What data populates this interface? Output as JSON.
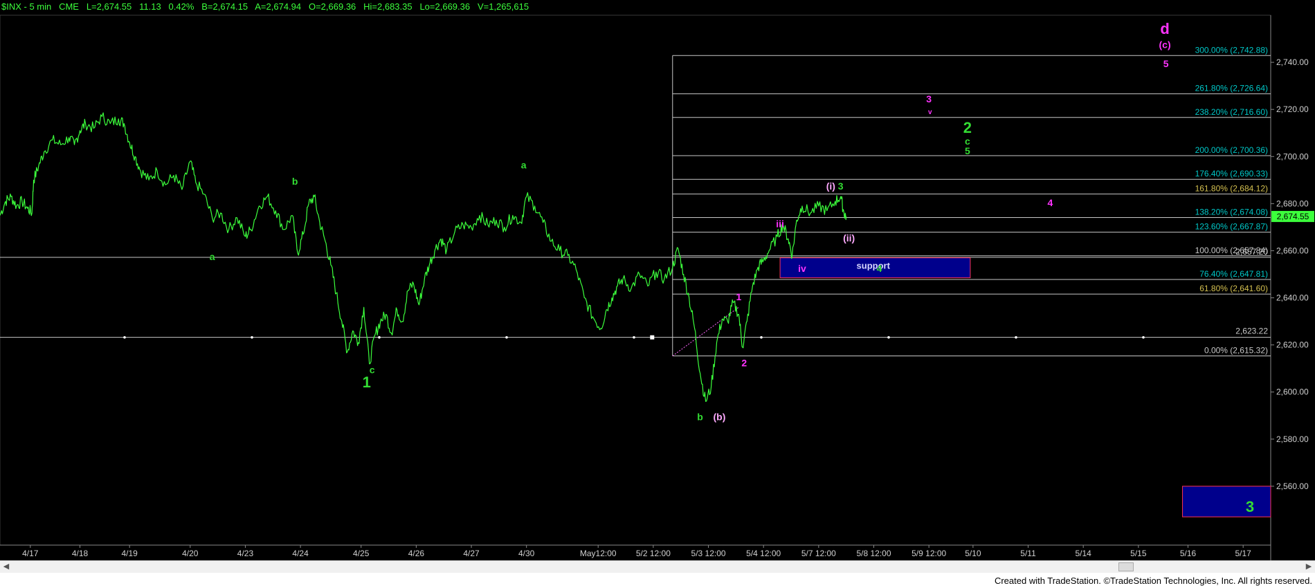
{
  "header": {
    "symbol": "$INX - 5 min",
    "exchange": "CME",
    "last": "L=2,674.55",
    "change": "11.13",
    "change_pct": "0.42%",
    "bid": "B=2,674.15",
    "ask": "A=2,674.94",
    "open": "O=2,669.36",
    "high": "Hi=2,683.35",
    "low": "Lo=2,669.36",
    "volume": "V=1,265,615"
  },
  "footer": {
    "credit": "Created with TradeStation. ©TradeStation Technologies, Inc. All rights reserved."
  },
  "colors": {
    "background": "#000000",
    "price": "#3cff3c",
    "wave_green": "#33dd33",
    "wave_magenta": "#ff33ff",
    "wave_pink": "#ffaaff",
    "fib_label": "#00c8c8",
    "fib_label_gold": "#d4c050",
    "fib_label_gray": "#c8c8c8",
    "box_fill": "#00008c",
    "box_border": "#ff3355",
    "last_price_tag": "#3cff3c"
  },
  "chart_data": {
    "type": "line",
    "ylim": [
      2535,
      2760
    ],
    "y_ticks": [
      {
        "value": 2740,
        "label": "2,740.00"
      },
      {
        "value": 2720,
        "label": "2,720.00"
      },
      {
        "value": 2700,
        "label": "2,700.00"
      },
      {
        "value": 2680,
        "label": "2,680.00"
      },
      {
        "value": 2660,
        "label": "2,660.00"
      },
      {
        "value": 2640,
        "label": "2,640.00"
      },
      {
        "value": 2620,
        "label": "2,620.00"
      },
      {
        "value": 2600,
        "label": "2,600.00"
      },
      {
        "value": 2580,
        "label": "2,580.00"
      },
      {
        "value": 2560,
        "label": "2,560.00"
      }
    ],
    "x_ticks": [
      "4/17",
      "4/18",
      "4/19",
      "4/20",
      "4/23",
      "4/24",
      "4/25",
      "4/26",
      "4/27",
      "4/30",
      "May12:00",
      "5/2 12:00",
      "5/3 12:00",
      "5/4 12:00",
      "5/7 12:00",
      "5/8 12:00",
      "5/9 12:00",
      "5/10",
      "5/11",
      "5/14",
      "5/15",
      "5/16",
      "5/17"
    ],
    "x_tick_pos": [
      0.3,
      1.2,
      2.1,
      3.2,
      4.2,
      5.2,
      6.3,
      7.3,
      8.3,
      9.3,
      10.6,
      11.6,
      12.6,
      13.6,
      14.6,
      15.6,
      16.6,
      17.4,
      18.4,
      19.4,
      20.4,
      21.3,
      22.3
    ],
    "x_range": [
      -0.25,
      22.8
    ],
    "last_price": {
      "value": 2674.55,
      "label": "2,674.55"
    },
    "series": [
      {
        "values": [
          [
            -0.25,
            2675
          ],
          [
            -0.15,
            2681
          ],
          [
            -0.05,
            2683
          ],
          [
            0.05,
            2679
          ],
          [
            0.15,
            2681
          ],
          [
            0.25,
            2678
          ],
          [
            0.33,
            2676
          ],
          [
            0.36,
            2690
          ],
          [
            0.45,
            2696
          ],
          [
            0.55,
            2702
          ],
          [
            0.7,
            2707
          ],
          [
            0.85,
            2705
          ],
          [
            1.0,
            2708
          ],
          [
            1.1,
            2705
          ],
          [
            1.2,
            2711
          ],
          [
            1.3,
            2714
          ],
          [
            1.45,
            2712
          ],
          [
            1.6,
            2717
          ],
          [
            1.75,
            2714
          ],
          [
            1.9,
            2716
          ],
          [
            2.0,
            2714
          ],
          [
            2.1,
            2706
          ],
          [
            2.2,
            2700
          ],
          [
            2.3,
            2694
          ],
          [
            2.45,
            2690
          ],
          [
            2.6,
            2694
          ],
          [
            2.75,
            2688
          ],
          [
            2.9,
            2692
          ],
          [
            3.05,
            2686
          ],
          [
            3.2,
            2698
          ],
          [
            3.3,
            2689
          ],
          [
            3.45,
            2684
          ],
          [
            3.6,
            2674
          ],
          [
            3.75,
            2676
          ],
          [
            3.9,
            2669
          ],
          [
            4.05,
            2674
          ],
          [
            4.2,
            2666
          ],
          [
            4.3,
            2669
          ],
          [
            4.45,
            2679
          ],
          [
            4.6,
            2683
          ],
          [
            4.75,
            2677
          ],
          [
            4.9,
            2669
          ],
          [
            5.05,
            2675
          ],
          [
            5.15,
            2659
          ],
          [
            5.25,
            2667
          ],
          [
            5.35,
            2680
          ],
          [
            5.45,
            2683
          ],
          [
            5.55,
            2672
          ],
          [
            5.65,
            2664
          ],
          [
            5.75,
            2654
          ],
          [
            5.85,
            2642
          ],
          [
            5.95,
            2630
          ],
          [
            6.05,
            2617
          ],
          [
            6.15,
            2626
          ],
          [
            6.25,
            2621
          ],
          [
            6.35,
            2636
          ],
          [
            6.45,
            2612
          ],
          [
            6.55,
            2624
          ],
          [
            6.65,
            2630
          ],
          [
            6.75,
            2633
          ],
          [
            6.85,
            2625
          ],
          [
            6.95,
            2635
          ],
          [
            7.05,
            2630
          ],
          [
            7.15,
            2643
          ],
          [
            7.25,
            2646
          ],
          [
            7.35,
            2637
          ],
          [
            7.45,
            2648
          ],
          [
            7.55,
            2655
          ],
          [
            7.65,
            2661
          ],
          [
            7.75,
            2665
          ],
          [
            7.85,
            2660
          ],
          [
            8.0,
            2668
          ],
          [
            8.15,
            2671
          ],
          [
            8.3,
            2670
          ],
          [
            8.45,
            2675
          ],
          [
            8.6,
            2671
          ],
          [
            8.75,
            2673
          ],
          [
            8.9,
            2670
          ],
          [
            9.05,
            2675
          ],
          [
            9.2,
            2672
          ],
          [
            9.3,
            2683
          ],
          [
            9.45,
            2679
          ],
          [
            9.6,
            2672
          ],
          [
            9.75,
            2664
          ],
          [
            9.9,
            2660
          ],
          [
            10.05,
            2658
          ],
          [
            10.2,
            2652
          ],
          [
            10.35,
            2640
          ],
          [
            10.5,
            2632
          ],
          [
            10.65,
            2627
          ],
          [
            10.75,
            2635
          ],
          [
            10.85,
            2640
          ],
          [
            10.95,
            2645
          ],
          [
            11.05,
            2648
          ],
          [
            11.2,
            2644
          ],
          [
            11.35,
            2650
          ],
          [
            11.5,
            2645
          ],
          [
            11.65,
            2651
          ],
          [
            11.8,
            2648
          ],
          [
            11.95,
            2653
          ],
          [
            12.05,
            2661
          ],
          [
            12.15,
            2650
          ],
          [
            12.25,
            2640
          ],
          [
            12.35,
            2627
          ],
          [
            12.45,
            2608
          ],
          [
            12.55,
            2596
          ],
          [
            12.65,
            2602
          ],
          [
            12.75,
            2621
          ],
          [
            12.85,
            2631
          ],
          [
            12.95,
            2630
          ],
          [
            13.05,
            2638
          ],
          [
            13.15,
            2633
          ],
          [
            13.22,
            2619
          ],
          [
            13.3,
            2630
          ],
          [
            13.4,
            2645
          ],
          [
            13.5,
            2653
          ],
          [
            13.6,
            2656
          ],
          [
            13.7,
            2660
          ],
          [
            13.85,
            2666
          ],
          [
            13.95,
            2671
          ],
          [
            14.05,
            2665
          ],
          [
            14.12,
            2658
          ],
          [
            14.2,
            2673
          ],
          [
            14.3,
            2679
          ],
          [
            14.45,
            2676
          ],
          [
            14.6,
            2679
          ],
          [
            14.75,
            2677
          ],
          [
            14.9,
            2681
          ],
          [
            15.0,
            2683
          ],
          [
            15.06,
            2676
          ],
          [
            15.1,
            2674.55
          ]
        ]
      }
    ],
    "h_lines": [
      {
        "value": 2623.22,
        "label": "2,623.22",
        "color": "#c8c8c8",
        "style": "dotted",
        "full_width": true
      },
      {
        "value": 2657.2,
        "label": "2,657.20",
        "color": "#c8c8c8",
        "style": "solid",
        "full_width": true
      }
    ],
    "fib_levels": [
      {
        "value": 2742.88,
        "label": "300.00% (2,742.88)",
        "kind": "cyan"
      },
      {
        "value": 2726.64,
        "label": "261.80% (2,726.64)",
        "kind": "cyan"
      },
      {
        "value": 2716.6,
        "label": "238.20% (2,716.60)",
        "kind": "cyan"
      },
      {
        "value": 2700.36,
        "label": "200.00% (2,700.36)",
        "kind": "cyan"
      },
      {
        "value": 2690.33,
        "label": "176.40% (2,690.33)",
        "kind": "cyan"
      },
      {
        "value": 2684.12,
        "label": "161.80% (2,684.12)",
        "kind": "gold"
      },
      {
        "value": 2674.08,
        "label": "138.20% (2,674.08)",
        "kind": "cyan"
      },
      {
        "value": 2667.87,
        "label": "123.60% (2,667.87)",
        "kind": "cyan"
      },
      {
        "value": 2657.84,
        "label": "100.00% (2,657.84)",
        "kind": "gray"
      },
      {
        "value": 2647.81,
        "label": "76.40% (2,647.81)",
        "kind": "cyan"
      },
      {
        "value": 2641.6,
        "label": "61.80% (2,641.60)",
        "kind": "gold"
      },
      {
        "value": 2615.32,
        "label": "0.00% (2,615.32)",
        "kind": "gray"
      }
    ],
    "fib_start_x": 11.95,
    "support_zone": {
      "x0": 13.9,
      "x1": 17.35,
      "y0": 2648.5,
      "y1": 2657,
      "label": "support"
    },
    "target_zone": {
      "x0": 21.2,
      "x1": 22.8,
      "y0": 2547,
      "y1": 2560,
      "label": "3"
    },
    "annotations": [
      {
        "text": "a",
        "x": 3.6,
        "y": 2656,
        "color": "green",
        "size": "small"
      },
      {
        "text": "b",
        "x": 5.1,
        "y": 2688,
        "color": "green",
        "size": "small"
      },
      {
        "text": "c",
        "x": 6.5,
        "y": 2608,
        "color": "green",
        "size": "small"
      },
      {
        "text": "1",
        "x": 6.4,
        "y": 2602,
        "color": "green",
        "size": "large"
      },
      {
        "text": "a",
        "x": 9.25,
        "y": 2695,
        "color": "green",
        "size": "small"
      },
      {
        "text": "b",
        "x": 12.45,
        "y": 2588,
        "color": "green",
        "size": "small"
      },
      {
        "text": "(b)",
        "x": 12.8,
        "y": 2588,
        "color": "pink",
        "size": "small"
      },
      {
        "text": "1",
        "x": 13.15,
        "y": 2639,
        "color": "magenta",
        "size": "small"
      },
      {
        "text": "2",
        "x": 13.25,
        "y": 2611,
        "color": "magenta",
        "size": "small"
      },
      {
        "text": "iii",
        "x": 13.9,
        "y": 2670,
        "color": "magenta",
        "size": "small"
      },
      {
        "text": "iv",
        "x": 14.3,
        "y": 2651,
        "color": "magenta",
        "size": "small"
      },
      {
        "text": "4",
        "x": 15.7,
        "y": 2651,
        "color": "green",
        "size": "small"
      },
      {
        "text": "(i)",
        "x": 14.82,
        "y": 2686,
        "color": "pink",
        "size": "small"
      },
      {
        "text": "3",
        "x": 15.0,
        "y": 2686,
        "color": "green",
        "size": "small"
      },
      {
        "text": "(ii)",
        "x": 15.15,
        "y": 2664,
        "color": "pink",
        "size": "small"
      },
      {
        "text": "3",
        "x": 16.6,
        "y": 2723,
        "color": "magenta",
        "size": "small"
      },
      {
        "text": "v",
        "x": 16.62,
        "y": 2718,
        "color": "magenta",
        "size": "tiny"
      },
      {
        "text": "2",
        "x": 17.3,
        "y": 2710,
        "color": "green",
        "size": "large"
      },
      {
        "text": "c",
        "x": 17.3,
        "y": 2705,
        "color": "green",
        "size": "small"
      },
      {
        "text": "5",
        "x": 17.3,
        "y": 2701,
        "color": "green",
        "size": "small"
      },
      {
        "text": "4",
        "x": 18.8,
        "y": 2679,
        "color": "magenta",
        "size": "small"
      },
      {
        "text": "d",
        "x": 20.88,
        "y": 2752,
        "color": "magenta",
        "size": "large"
      },
      {
        "text": "(c)",
        "x": 20.88,
        "y": 2746,
        "color": "magenta",
        "size": "small"
      },
      {
        "text": "5",
        "x": 20.9,
        "y": 2738,
        "color": "magenta",
        "size": "small"
      }
    ]
  }
}
